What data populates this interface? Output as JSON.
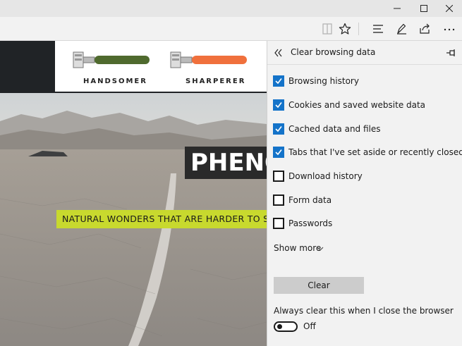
{
  "window": {
    "controls": [
      "minimize",
      "maximize",
      "close"
    ]
  },
  "toolbar": {
    "icons": [
      "reading-view-icon",
      "favorite-star-icon",
      "hub-icon",
      "web-note-icon",
      "share-icon",
      "more-icon"
    ]
  },
  "webpage": {
    "ad": {
      "product_1": "HANDSOMER",
      "product_2": "SHARPERER",
      "colors": {
        "razor_1": "#4f6a2e",
        "razor_2": "#f0703c"
      }
    },
    "headline": "PHENO",
    "tagline": "NATURAL WONDERS THAT ARE HARDER TO SEE",
    "colors": {
      "tagline_bg": "#c8d92e",
      "headline_bg": "#2a2a2a"
    }
  },
  "panel": {
    "title": "Clear browsing data",
    "checkboxes": [
      {
        "label": "Browsing history",
        "checked": true
      },
      {
        "label": "Cookies and saved website data",
        "checked": true
      },
      {
        "label": "Cached data and files",
        "checked": true
      },
      {
        "label": "Tabs that I've set aside or recently closed",
        "checked": true
      },
      {
        "label": "Download history",
        "checked": false
      },
      {
        "label": "Form data",
        "checked": false
      },
      {
        "label": "Passwords",
        "checked": false
      }
    ],
    "show_more": "Show more",
    "clear_button": "Clear",
    "always_clear_label": "Always clear this when I close the browser",
    "toggle": {
      "state": "Off",
      "on": false
    },
    "colors": {
      "accent": "#1473c9"
    }
  }
}
